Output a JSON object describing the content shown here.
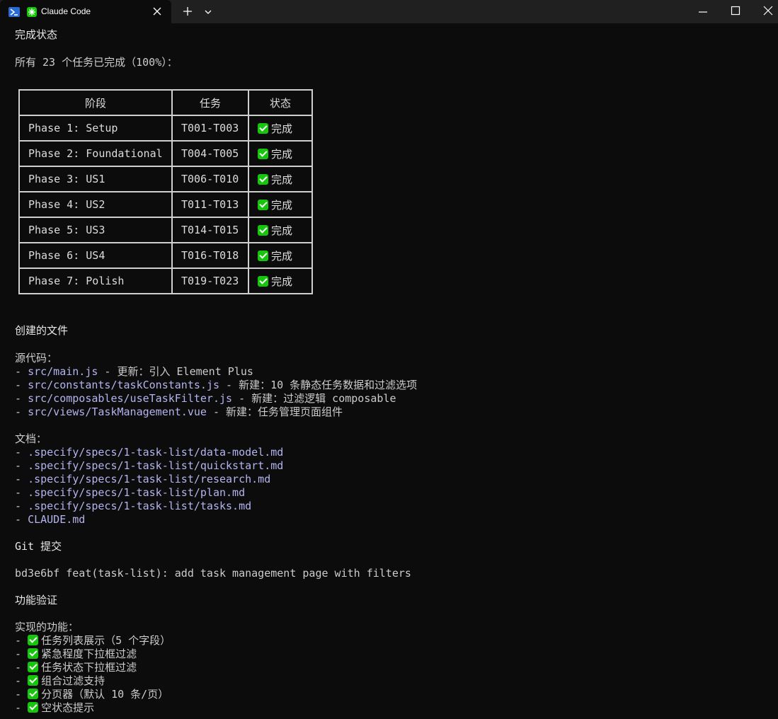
{
  "window": {
    "tab_title": "Claude Code"
  },
  "status": {
    "heading": "完成状态",
    "summary": "所有 23 个任务已完成（100%）："
  },
  "table": {
    "headers": [
      "阶段",
      "任务",
      "状态"
    ],
    "rows": [
      {
        "phase": "Phase 1: Setup",
        "tasks": "T001-T003",
        "status": "完成"
      },
      {
        "phase": "Phase 2: Foundational",
        "tasks": "T004-T005",
        "status": "完成"
      },
      {
        "phase": "Phase 3: US1",
        "tasks": "T006-T010",
        "status": "完成"
      },
      {
        "phase": "Phase 4: US2",
        "tasks": "T011-T013",
        "status": "完成"
      },
      {
        "phase": "Phase 5: US3",
        "tasks": "T014-T015",
        "status": "完成"
      },
      {
        "phase": "Phase 6: US4",
        "tasks": "T016-T018",
        "status": "完成"
      },
      {
        "phase": "Phase 7: Polish",
        "tasks": "T019-T023",
        "status": "完成"
      }
    ]
  },
  "files": {
    "heading": "创建的文件",
    "source_label": "源代码：",
    "source": [
      {
        "path": "src/main.js",
        "desc": " - 更新：引入 Element Plus"
      },
      {
        "path": "src/constants/taskConstants.js",
        "desc": " - 新建：10 条静态任务数据和过滤选项"
      },
      {
        "path": "src/composables/useTaskFilter.js",
        "desc": " - 新建：过滤逻辑 composable"
      },
      {
        "path": "src/views/TaskManagement.vue",
        "desc": " - 新建：任务管理页面组件"
      }
    ],
    "docs_label": "文档：",
    "docs": [
      ".specify/specs/1-task-list/data-model.md",
      ".specify/specs/1-task-list/quickstart.md",
      ".specify/specs/1-task-list/research.md",
      ".specify/specs/1-task-list/plan.md",
      ".specify/specs/1-task-list/tasks.md",
      "CLAUDE.md"
    ]
  },
  "git": {
    "heading": "Git 提交",
    "commit": "bd3e6bf feat(task-list): add task management page with filters"
  },
  "features": {
    "heading": "功能验证",
    "label": "实现的功能：",
    "items": [
      "任务列表展示（5 个字段）",
      "紧急程度下拉框过滤",
      "任务状态下拉框过滤",
      "组合过滤支持",
      "分页器（默认 10 条/页）",
      "空状态提示"
    ]
  },
  "colors": {
    "background": "#0c0c0c",
    "text": "#cccccc",
    "link": "#b4b4f0",
    "check": "#16c60c"
  }
}
